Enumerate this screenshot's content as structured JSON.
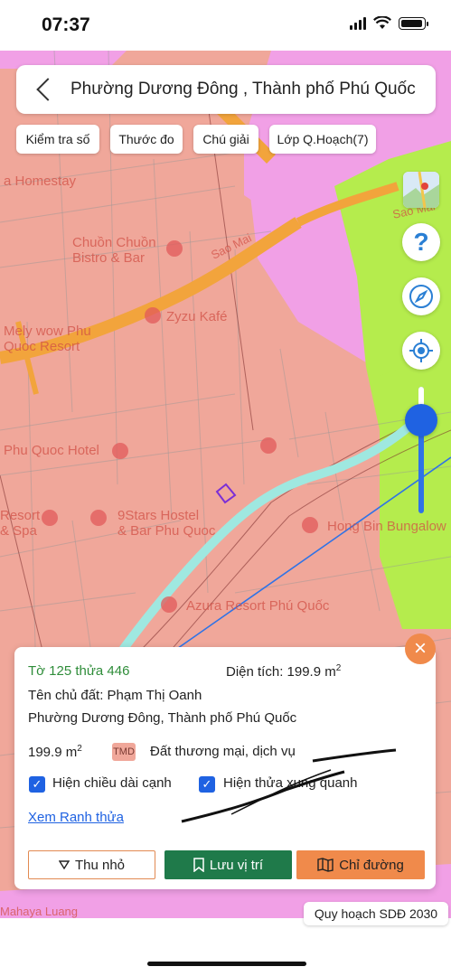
{
  "status": {
    "time": "07:37"
  },
  "search": {
    "title": "Phường Dương Đông , Thành phố Phú Quốc"
  },
  "chips": [
    "Kiểm tra số",
    "Thước đo",
    "Chú giải",
    "Lớp Q.Hoạch(7)"
  ],
  "map_labels": {
    "homestay": "a Homestay",
    "chuon": "Chuồn Chuồn\nBistro & Bar",
    "zyzu": "Zyzu Kafé",
    "mely": "Mely wow Phu\nQuoc Resort",
    "phuquoc_hotel": "Phu Quoc Hotel",
    "resort_spa": "Resort\n& Spa",
    "ninestars": "9Stars Hostel\n& Bar Phu Quoc",
    "hong_bin": "Hong Bin Bungalow",
    "azura": "Azura Resort Phú Quốc",
    "street": "Sao Mai",
    "street2": "Sao Mai",
    "mahaya": "Mahaya Luang"
  },
  "card": {
    "parcel": "Tờ 125 thửa 446",
    "area_label": "Diện tích: 199.9 m",
    "area_sup": "2",
    "owner": "Tên chủ đất: Phạm Thị Oanh",
    "address": "Phường Dương Đông, Thành phố Phú Quốc",
    "area_value": "199.9 m",
    "area_value_sup": "2",
    "land_code": "TMD",
    "land_type": "Đất thương mại, dịch vụ",
    "check_edges": "Hiện chiều dài cạnh",
    "check_neighbors": "Hiện thửa xung quanh",
    "boundary_link": "Xem Ranh thửa",
    "btn_collapse": "Thu nhỏ",
    "btn_save": "Lưu vị trí",
    "btn_directions": "Chỉ đường",
    "close": "×"
  },
  "footer": {
    "plan_label": "Quy hoạch SDĐ 2030"
  },
  "colors": {
    "commercial": "#f0a79a",
    "pink_zone": "#f1a0e6",
    "green_zone": "#b5ec4d",
    "road": "#f2a43c",
    "river": "#9fe8e0",
    "accent_blue": "#1f62e2",
    "save_green": "#1f7a4a",
    "orange": "#f08a4b"
  }
}
